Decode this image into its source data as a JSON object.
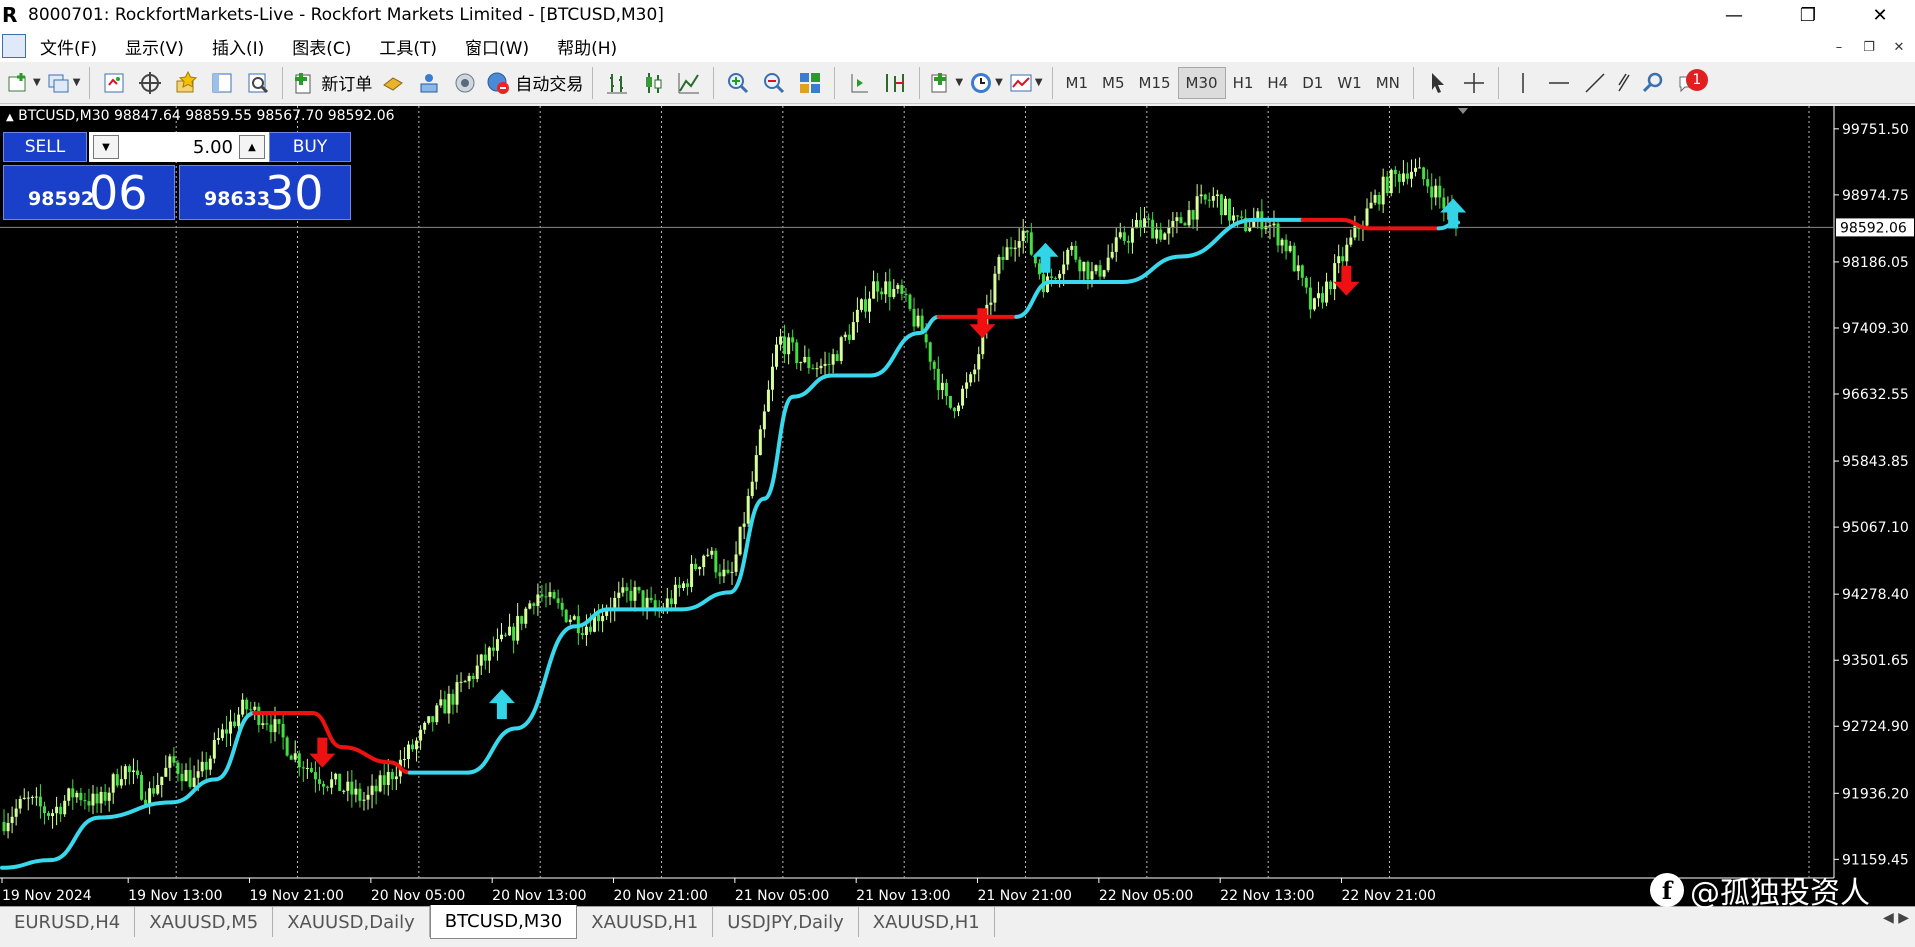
{
  "window": {
    "title": "8000701: RockfortMarkets-Live - Rockfort Markets Limited - [BTCUSD,M30]",
    "logo_text": "R"
  },
  "menu": [
    "文件(F)",
    "显示(V)",
    "插入(I)",
    "图表(C)",
    "工具(T)",
    "窗口(W)",
    "帮助(H)"
  ],
  "toolbar": {
    "new_order_label": "新订单",
    "auto_trade_label": "自动交易",
    "timeframes": [
      "M1",
      "M5",
      "M15",
      "M30",
      "H1",
      "H4",
      "D1",
      "W1",
      "MN"
    ],
    "active_timeframe": "M30",
    "notification_count": "1"
  },
  "chart": {
    "info_line": "BTCUSD,M30  98847.64 98859.55 98567.70 98592.06",
    "sell_label": "SELL",
    "buy_label": "BUY",
    "lot": "5.00",
    "sell_price_small": "98592",
    "sell_price_big": "06",
    "buy_price_small": "98633",
    "buy_price_big": "30",
    "current_price_label": "98592.06"
  },
  "chart_data": {
    "type": "candlestick",
    "symbol": "BTCUSD",
    "timeframe": "M30",
    "y_ticks": [
      99751.5,
      98974.75,
      98186.05,
      97409.3,
      96632.55,
      95843.85,
      95067.1,
      94278.4,
      93501.65,
      92724.9,
      91936.2,
      91159.45
    ],
    "y_tick_labels": [
      "99751.50",
      "98974.75",
      "98186.05",
      "97409.30",
      "96632.55",
      "95843.85",
      "95067.10",
      "94278.40",
      "93501.65",
      "92724.90",
      "91936.20",
      "91159.45"
    ],
    "x_tick_labels": [
      "19 Nov 2024",
      "19 Nov 13:00",
      "19 Nov 21:00",
      "20 Nov 05:00",
      "20 Nov 13:00",
      "20 Nov 21:00",
      "21 Nov 05:00",
      "21 Nov 13:00",
      "21 Nov 21:00",
      "22 Nov 05:00",
      "22 Nov 13:00",
      "22 Nov 21:00"
    ],
    "current_price": 98592.06,
    "ylim": [
      90940,
      100020
    ],
    "close_path": [
      {
        "t": 0,
        "p": 91600
      },
      {
        "t": 0.5,
        "p": 91850
      },
      {
        "t": 1,
        "p": 91700
      },
      {
        "t": 1.5,
        "p": 91950
      },
      {
        "t": 2,
        "p": 91800
      },
      {
        "t": 2.5,
        "p": 92250
      },
      {
        "t": 3,
        "p": 91900
      },
      {
        "t": 3.5,
        "p": 92300
      },
      {
        "t": 4,
        "p": 92050
      },
      {
        "t": 4.5,
        "p": 92600
      },
      {
        "t": 5,
        "p": 92950
      },
      {
        "t": 5.5,
        "p": 92800
      },
      {
        "t": 6,
        "p": 92400
      },
      {
        "t": 6.5,
        "p": 92150
      },
      {
        "t": 7,
        "p": 92000
      },
      {
        "t": 7.5,
        "p": 91850
      },
      {
        "t": 8,
        "p": 92150
      },
      {
        "t": 8.5,
        "p": 92500
      },
      {
        "t": 9,
        "p": 92900
      },
      {
        "t": 9.5,
        "p": 93200
      },
      {
        "t": 10,
        "p": 93550
      },
      {
        "t": 10.5,
        "p": 93800
      },
      {
        "t": 11,
        "p": 94300
      },
      {
        "t": 11.5,
        "p": 94100
      },
      {
        "t": 12,
        "p": 93900
      },
      {
        "t": 12.5,
        "p": 94150
      },
      {
        "t": 13,
        "p": 94300
      },
      {
        "t": 13.5,
        "p": 94050
      },
      {
        "t": 14,
        "p": 94350
      },
      {
        "t": 14.5,
        "p": 94800
      },
      {
        "t": 15,
        "p": 94400
      },
      {
        "t": 15.5,
        "p": 95700
      },
      {
        "t": 16,
        "p": 97300
      },
      {
        "t": 16.5,
        "p": 97000
      },
      {
        "t": 17,
        "p": 96950
      },
      {
        "t": 17.5,
        "p": 97400
      },
      {
        "t": 18,
        "p": 97950
      },
      {
        "t": 18.5,
        "p": 97800
      },
      {
        "t": 19,
        "p": 97300
      },
      {
        "t": 19.5,
        "p": 96450
      },
      {
        "t": 20,
        "p": 96800
      },
      {
        "t": 20.5,
        "p": 98100
      },
      {
        "t": 21,
        "p": 98600
      },
      {
        "t": 21.5,
        "p": 97900
      },
      {
        "t": 22,
        "p": 98350
      },
      {
        "t": 22.5,
        "p": 98000
      },
      {
        "t": 23,
        "p": 98400
      },
      {
        "t": 23.5,
        "p": 98650
      },
      {
        "t": 24,
        "p": 98500
      },
      {
        "t": 24.5,
        "p": 98800
      },
      {
        "t": 25,
        "p": 98950
      },
      {
        "t": 25.5,
        "p": 98600
      },
      {
        "t": 26,
        "p": 98700
      },
      {
        "t": 26.5,
        "p": 98350
      },
      {
        "t": 27,
        "p": 97600
      },
      {
        "t": 27.5,
        "p": 98100
      },
      {
        "t": 28,
        "p": 98650
      },
      {
        "t": 28.5,
        "p": 99100
      },
      {
        "t": 29,
        "p": 99300
      },
      {
        "t": 29.5,
        "p": 99050
      },
      {
        "t": 30,
        "p": 98592
      }
    ],
    "indicator_line": [
      {
        "t": 0,
        "p": 91060,
        "c": "up"
      },
      {
        "t": 1,
        "p": 91150,
        "c": "up"
      },
      {
        "t": 2,
        "p": 91650,
        "c": "up"
      },
      {
        "t": 3.5,
        "p": 91830,
        "c": "up"
      },
      {
        "t": 4.4,
        "p": 92100,
        "c": "up"
      },
      {
        "t": 5.2,
        "p": 92880,
        "c": "up"
      },
      {
        "t": 6.4,
        "p": 92880,
        "c": "down"
      },
      {
        "t": 7,
        "p": 92480,
        "c": "down"
      },
      {
        "t": 8,
        "p": 92300,
        "c": "down"
      },
      {
        "t": 8.4,
        "p": 92180,
        "c": "down"
      },
      {
        "t": 9.6,
        "p": 92180,
        "c": "up"
      },
      {
        "t": 10.6,
        "p": 92700,
        "c": "up"
      },
      {
        "t": 11.8,
        "p": 93900,
        "c": "up"
      },
      {
        "t": 12.5,
        "p": 94100,
        "c": "up"
      },
      {
        "t": 14,
        "p": 94100,
        "c": "up"
      },
      {
        "t": 15,
        "p": 94300,
        "c": "up"
      },
      {
        "t": 15.7,
        "p": 95400,
        "c": "up"
      },
      {
        "t": 16.3,
        "p": 96600,
        "c": "up"
      },
      {
        "t": 17.1,
        "p": 96850,
        "c": "up"
      },
      {
        "t": 17.9,
        "p": 96850,
        "c": "up"
      },
      {
        "t": 18.9,
        "p": 97350,
        "c": "up"
      },
      {
        "t": 19.3,
        "p": 97540,
        "c": "up"
      },
      {
        "t": 20.1,
        "p": 97540,
        "c": "down"
      },
      {
        "t": 20.9,
        "p": 97540,
        "c": "down"
      },
      {
        "t": 21.6,
        "p": 97950,
        "c": "up"
      },
      {
        "t": 23.1,
        "p": 97950,
        "c": "up"
      },
      {
        "t": 24.3,
        "p": 98250,
        "c": "up"
      },
      {
        "t": 25.8,
        "p": 98680,
        "c": "up"
      },
      {
        "t": 26.8,
        "p": 98680,
        "c": "up"
      },
      {
        "t": 27.6,
        "p": 98680,
        "c": "down"
      },
      {
        "t": 28.2,
        "p": 98580,
        "c": "down"
      },
      {
        "t": 29.6,
        "p": 98580,
        "c": "down"
      },
      {
        "t": 30,
        "p": 98650,
        "c": "up"
      }
    ],
    "signals": [
      {
        "t": 6.6,
        "p": 92450,
        "dir": "sell"
      },
      {
        "t": 10.3,
        "p": 92950,
        "dir": "buy"
      },
      {
        "t": 20.2,
        "p": 97500,
        "dir": "sell"
      },
      {
        "t": 21.5,
        "p": 98200,
        "dir": "buy"
      },
      {
        "t": 27.7,
        "p": 98000,
        "dir": "sell"
      },
      {
        "t": 29.9,
        "p": 98720,
        "dir": "buy"
      }
    ],
    "colors": {
      "background": "#000000",
      "candle_up": "#d6ff9a",
      "candle_down": "#44dd44",
      "line_up": "#3ad8ec",
      "line_down": "#ee1111",
      "arrow_up": "#33d4e8",
      "arrow_down": "#ee1111",
      "grid": "#bbbbbb"
    }
  },
  "tabs": [
    "EURUSD,H4",
    "XAUUSD,M5",
    "XAUUSD,Daily",
    "BTCUSD,M30",
    "XAUUSD,H1",
    "USDJPY,Daily",
    "XAUUSD,H1"
  ],
  "active_tab": "BTCUSD,M30",
  "watermark": {
    "logo": "f",
    "text": "@孤独投资人"
  }
}
